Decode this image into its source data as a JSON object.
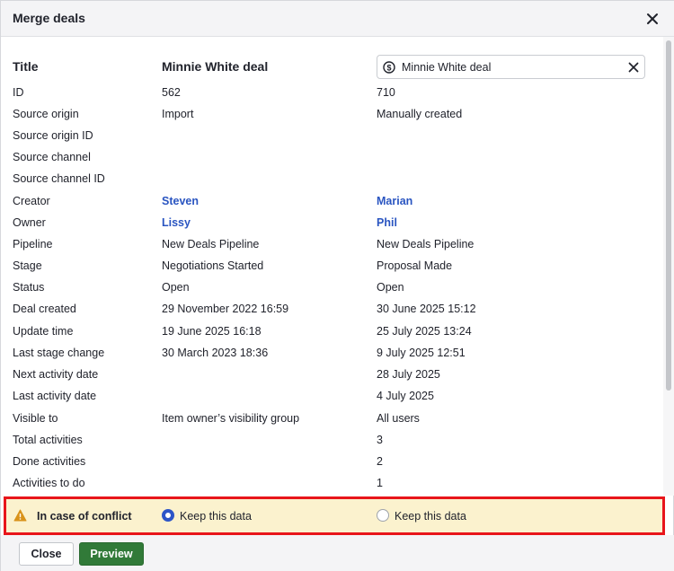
{
  "dialog": {
    "title": "Merge deals"
  },
  "title_row": {
    "label": "Title",
    "left_value": "Minnie White deal",
    "right_input_value": "Minnie White deal"
  },
  "rows": [
    {
      "label": "ID",
      "left": "562",
      "right": "710"
    },
    {
      "label": "Source origin",
      "left": "Import",
      "right": "Manually created"
    },
    {
      "label": "Source origin ID",
      "left": "",
      "right": ""
    },
    {
      "label": "Source channel",
      "left": "",
      "right": ""
    },
    {
      "label": "Source channel ID",
      "left": "",
      "right": ""
    },
    {
      "label": "Creator",
      "left": "Steven",
      "right": "Marian"
    },
    {
      "label": "Owner",
      "left": "Lissy",
      "right": "Phil"
    },
    {
      "label": "Pipeline",
      "left": "New Deals Pipeline",
      "right": "New Deals Pipeline"
    },
    {
      "label": "Stage",
      "left": "Negotiations Started",
      "right": "Proposal Made"
    },
    {
      "label": "Status",
      "left": "Open",
      "right": "Open"
    },
    {
      "label": "Deal created",
      "left": "29 November 2022 16:59",
      "right": "30 June 2025 15:12"
    },
    {
      "label": "Update time",
      "left": "19 June 2025 16:18",
      "right": "25 July 2025 13:24"
    },
    {
      "label": "Last stage change",
      "left": "30 March 2023 18:36",
      "right": "9 July 2025 12:51"
    },
    {
      "label": "Next activity date",
      "left": "",
      "right": "28 July 2025"
    },
    {
      "label": "Last activity date",
      "left": "",
      "right": "4 July 2025"
    },
    {
      "label": "Visible to",
      "left": "Item owner’s visibility group",
      "right": "All users"
    },
    {
      "label": "Total activities",
      "left": "",
      "right": "3"
    },
    {
      "label": "Done activities",
      "left": "",
      "right": "2"
    },
    {
      "label": "Activities to do",
      "left": "",
      "right": "1"
    }
  ],
  "conflict": {
    "label": "In case of conflict",
    "left_option": "Keep this data",
    "right_option": "Keep this data",
    "selected": "left"
  },
  "footer": {
    "close_label": "Close",
    "preview_label": "Preview"
  },
  "icons": {
    "close": "close-icon",
    "deal": "dollar-circle-icon",
    "clear": "clear-icon",
    "warning": "warning-icon"
  },
  "colors": {
    "link": "#2a55c1",
    "primary_button": "#317a38",
    "conflict_bg": "#fbf2ce",
    "highlight_border": "#e8151b",
    "warning": "#d9931a"
  }
}
